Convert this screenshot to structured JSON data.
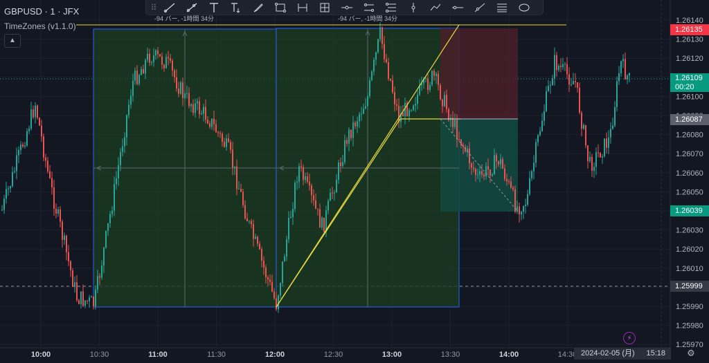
{
  "symbol": {
    "title": "GBPUSD · 1 · JFX",
    "indicator": "TimeZones (v1.1.0)",
    "collapse_icon": "chevron-up-icon"
  },
  "toolbar": {
    "drag_icon": "drag-handle-icon",
    "tools": [
      {
        "name": "trend-line-tool",
        "icon": "trend-line-icon"
      },
      {
        "name": "ray-tool",
        "icon": "ray-icon"
      },
      {
        "name": "text-tool",
        "icon": "text-icon"
      },
      {
        "name": "anchored-text-tool",
        "icon": "anchored-text-icon"
      },
      {
        "name": "brush-tool",
        "icon": "brush-icon"
      },
      {
        "name": "rectangle-tool",
        "icon": "rectangle-icon"
      },
      {
        "name": "date-range-tool",
        "icon": "date-range-icon"
      },
      {
        "name": "date-price-range-tool",
        "icon": "date-price-range-icon"
      },
      {
        "name": "horizontal-ray-tool",
        "icon": "horizontal-ray-icon"
      },
      {
        "name": "parallel-channel-tool",
        "icon": "parallel-channel-icon"
      },
      {
        "name": "pitchfork-tool",
        "icon": "pitchfork-icon"
      },
      {
        "name": "vertical-line-tool",
        "icon": "vertical-line-icon"
      },
      {
        "name": "path-tool",
        "icon": "path-icon"
      },
      {
        "name": "horizontal-line-tool",
        "icon": "horizontal-line-icon"
      },
      {
        "name": "extended-line-tool",
        "icon": "extended-line-icon"
      },
      {
        "name": "fib-lines-tool",
        "icon": "fib-lines-icon"
      },
      {
        "name": "ellipse-tool",
        "icon": "ellipse-icon"
      }
    ]
  },
  "drawings": {
    "range_label_1": "-94 バー, -1時間 34分",
    "range_label_2": "-94 バー, -1時間 34分"
  },
  "price_axis": {
    "ticks": [
      "1.26140",
      "1.26130",
      "1.26120",
      "1.26110",
      "1.26100",
      "1.26090",
      "1.26080",
      "1.26070",
      "1.26060",
      "1.26050",
      "1.26040",
      "1.26030",
      "1.26020",
      "1.26010",
      "1.26000",
      "1.25990",
      "1.25980",
      "1.25970"
    ],
    "tags": {
      "target": "1.26135",
      "current": "1.26109",
      "countdown": "00:20",
      "entry": "1.26087",
      "stop_region": "1.26039",
      "crosshair": "1.25999"
    }
  },
  "time_axis": {
    "ticks": [
      "10:00",
      "10:30",
      "11:00",
      "11:30",
      "12:00",
      "12:30",
      "13:00",
      "13:30",
      "14:00",
      "14:30"
    ],
    "date": "2024-02-05 (月)",
    "clock": "15:18"
  },
  "colors": {
    "background": "#131722",
    "up": "#26a69a",
    "down": "#ef5350",
    "box_fill": "#1c3b22",
    "box_border": "#2962ff",
    "trend_line": "#e6d93f",
    "target_zone": "#4a1f28",
    "stop_zone": "#124a40"
  },
  "buttons": {
    "settings_icon": "gear-icon",
    "lightning_icon": "lightning-icon"
  }
}
